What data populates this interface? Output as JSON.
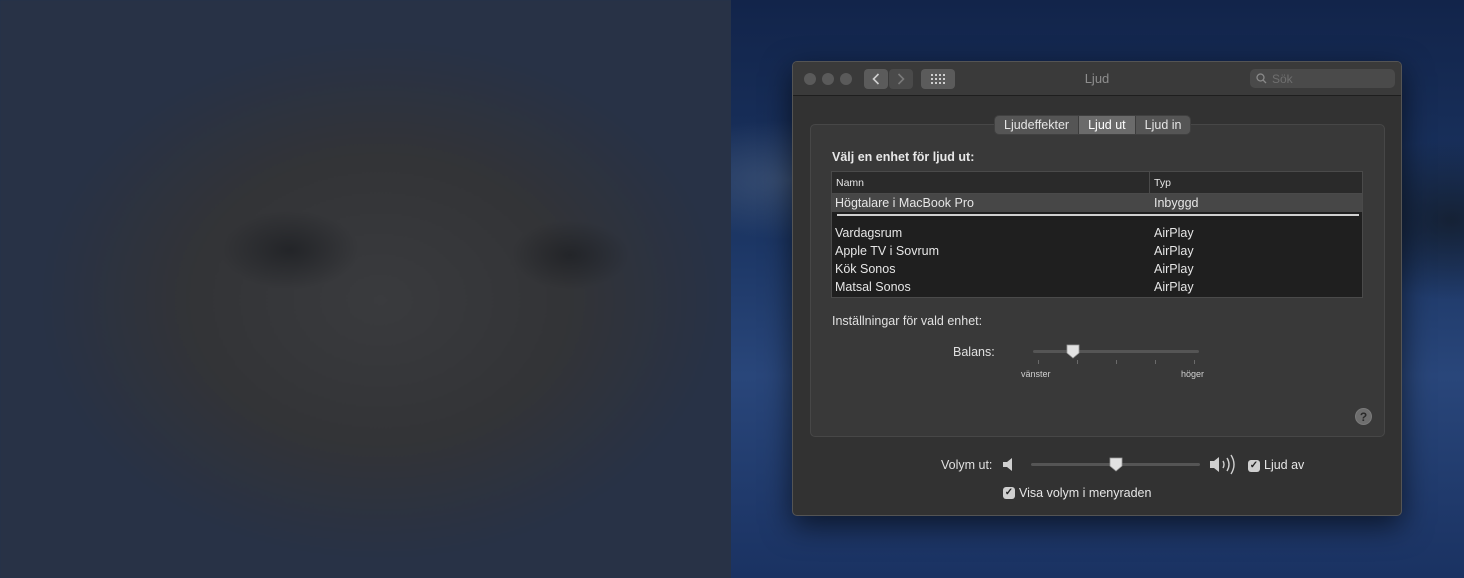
{
  "window": {
    "title": "Ljud"
  },
  "search": {
    "placeholder": "Sök"
  },
  "tabs": [
    {
      "label": "Ljudeffekter",
      "active": false
    },
    {
      "label": "Ljud ut",
      "active": true
    },
    {
      "label": "Ljud in",
      "active": false
    }
  ],
  "output": {
    "section_title": "Välj en enhet för ljud ut:",
    "columns": {
      "name": "Namn",
      "type": "Typ"
    },
    "devices": [
      {
        "name": "Högtalare i MacBook Pro",
        "type": "Inbyggd",
        "selected": true
      },
      {
        "name": "Vardagsrum",
        "type": "AirPlay",
        "selected": false
      },
      {
        "name": "Apple TV i Sovrum",
        "type": "AirPlay",
        "selected": false
      },
      {
        "name": "Kök Sonos",
        "type": "AirPlay",
        "selected": false
      },
      {
        "name": "Matsal Sonos",
        "type": "AirPlay",
        "selected": false
      }
    ],
    "settings_label": "Inställningar för vald enhet:",
    "balance": {
      "label": "Balans:",
      "left_label": "vänster",
      "right_label": "höger",
      "value": 0.24
    }
  },
  "volume": {
    "label": "Volym ut:",
    "value": 0.5,
    "mute_label": "Ljud av",
    "mute_checked": true,
    "show_in_menubar_label": "Visa volym i menyraden",
    "show_in_menubar_checked": true
  },
  "colors": {
    "window_bg": "#323232",
    "selected_row": "#474747",
    "accent_checkbox": "#cfcfcf"
  }
}
